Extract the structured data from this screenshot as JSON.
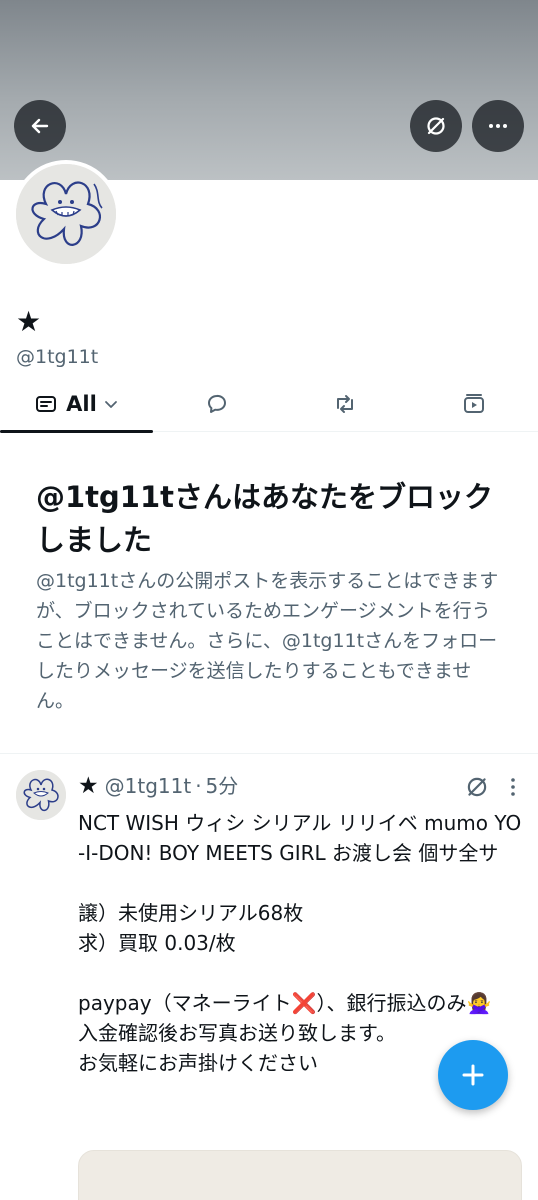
{
  "header": {
    "back_icon": "arrow-left-icon",
    "hide_icon": "eye-slash-icon",
    "more_icon": "more-horizontal-icon"
  },
  "profile": {
    "name": "★",
    "handle": "@1tg11t"
  },
  "tabs": [
    {
      "label": "All",
      "icon": "feed-icon",
      "active": true
    },
    {
      "label": "",
      "icon": "reply-icon"
    },
    {
      "label": "",
      "icon": "repost-icon"
    },
    {
      "label": "",
      "icon": "video-icon"
    }
  ],
  "block_notice": {
    "title": "@1tg11tさんはあなたをブロックしました",
    "description": "@1tg11tさんの公開ポストを表示することはできますが、ブロックされているためエンゲージメントを行うことはできません。さらに、@1tg11tさんをフォローしたりメッセージを送信したりすることもできません。"
  },
  "post": {
    "name": "★",
    "handle": "@1tg11t",
    "separator": "·",
    "time": "5分",
    "text": "NCT WISH ウィシ シリアル リリイベ mumo YO-I-DON! BOY MEETS GIRL お渡し会 個サ全サ\n\n譲）未使用シリアル68枚\n求）買取 0.03/枚\n\npaypay（マネーライト❌）、銀行振込のみ🙅‍♀️\n入金確認後お写真お送り致します。\nお気軽にお声掛けください"
  },
  "fab": {
    "icon": "plus-icon"
  },
  "colors": {
    "accent": "#1d9bf0",
    "secondary_text": "#536471"
  }
}
